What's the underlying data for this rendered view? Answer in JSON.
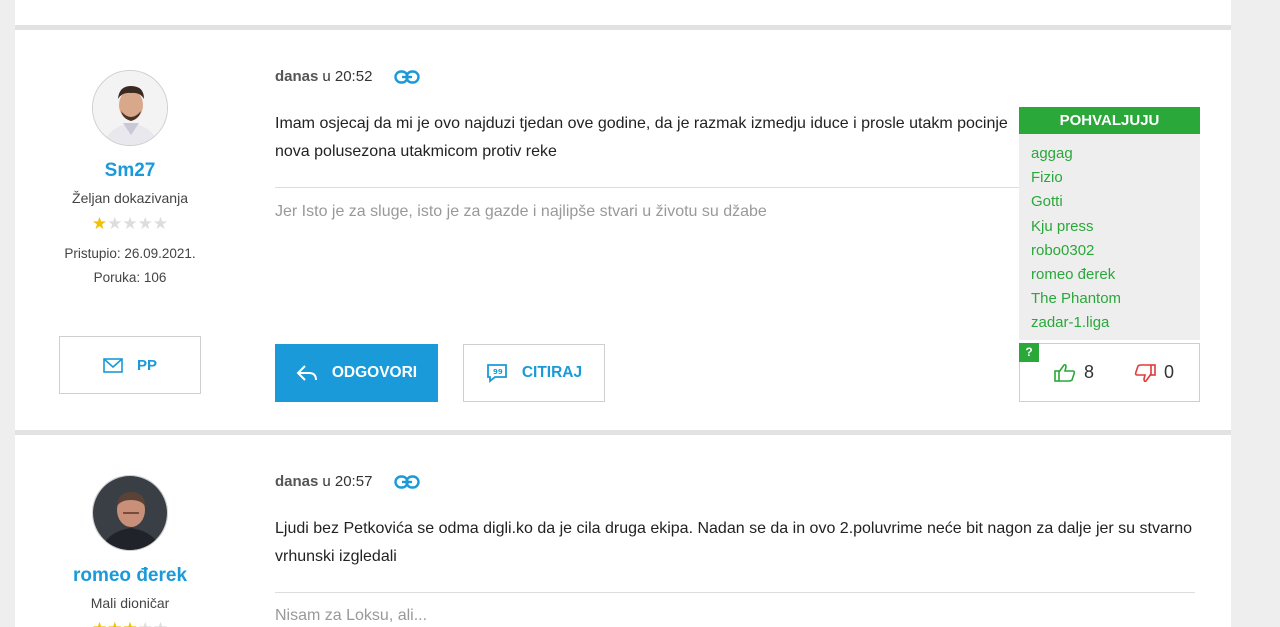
{
  "posts": [
    {
      "user": {
        "name": "Sm27",
        "rank": "Željan dokazivanja",
        "stars_filled": 1,
        "stars_total": 5,
        "joined": "Pristupio: 26.09.2021.",
        "posts": "Poruka: 106",
        "pm_label": "PP"
      },
      "date_day": "danas",
      "date_rest": "u 20:52",
      "text": "Imam osjecaj da mi je ovo najduzi tjedan ove godine, da je razmak izmedju iduce i prosle  utakm pocinje nova polusezona utakmicom protiv reke",
      "signature": "Jer Isto je za sluge, isto je za gazde i najlipše stvari u životu su džabe",
      "reply_label": "ODGOVORI",
      "quote_label": "CITIRAJ",
      "praise": {
        "title": "POHVALJUJU",
        "users": [
          "aggag",
          "Fizio",
          "Gotti",
          "Kju press",
          "robo0302",
          "romeo đerek",
          "The Phantom",
          "zadar-1.liga"
        ],
        "help": "?",
        "likes": "8",
        "dislikes": "0"
      }
    },
    {
      "user": {
        "name": "romeo đerek",
        "rank": "Mali dioničar"
      },
      "date_day": "danas",
      "date_rest": "u 20:57",
      "text": "Ljudi bez Petkovića se odma digli.ko da je cila druga ekipa. Nadan se da in ovo 2.poluvrime neće bit nagon za dalje jer su stvarno vrhunski izgledali",
      "signature": "Nisam za Loksu, ali..."
    }
  ],
  "colors": {
    "accent": "#1a9ad8",
    "praise": "#2aa83a",
    "dislike": "#e03b3b",
    "star": "#f2c100"
  },
  "icons": [
    "permalink-icon",
    "envelope-icon",
    "reply-arrow-icon",
    "quote-bubble-icon",
    "thumbs-up-icon",
    "thumbs-down-icon",
    "star-icon"
  ]
}
